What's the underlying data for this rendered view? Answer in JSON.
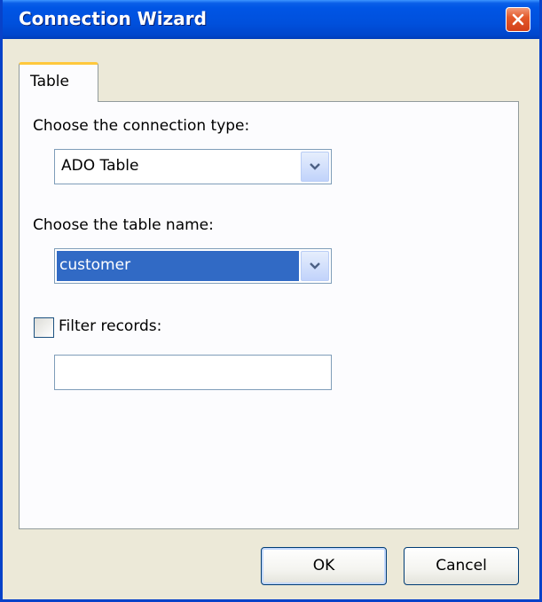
{
  "window": {
    "title": "Connection Wizard",
    "close_icon": "close-icon"
  },
  "tabs": [
    {
      "label": "Table",
      "active": true
    }
  ],
  "form": {
    "connection_type_label": "Choose the connection type:",
    "connection_type_value": "ADO Table",
    "table_name_label": "Choose the table name:",
    "table_name_value": "customer",
    "filter_label": "Filter records:",
    "filter_checked": false,
    "filter_value": ""
  },
  "buttons": {
    "ok": "OK",
    "cancel": "Cancel"
  },
  "colors": {
    "titlebar": "#0050dc",
    "selection": "#316ac5",
    "tab_accent": "#ffc83c",
    "close": "#e45a2b"
  }
}
